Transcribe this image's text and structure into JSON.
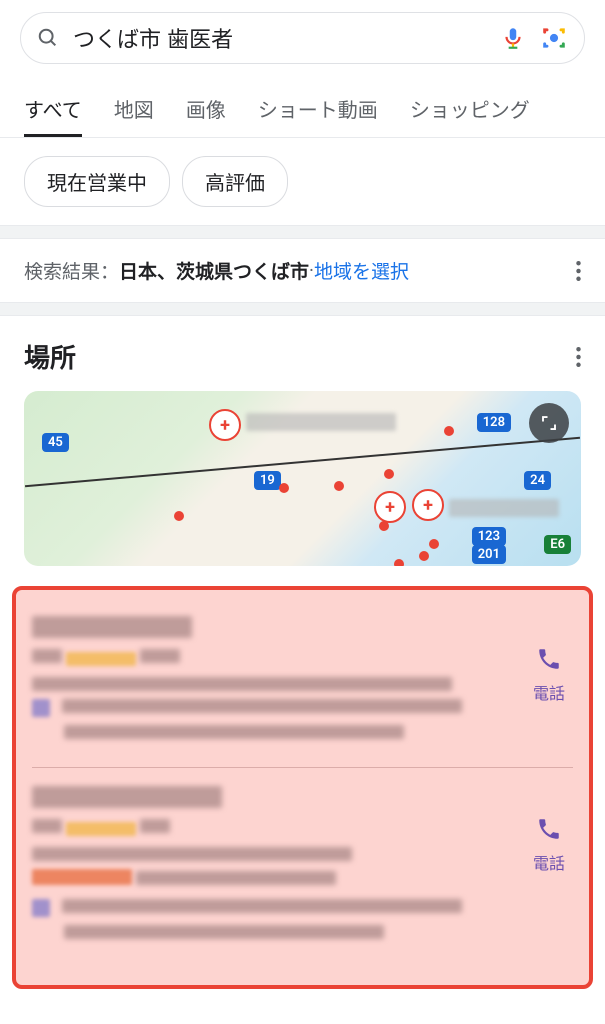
{
  "search": {
    "query": "つくば市 歯医者"
  },
  "tabs": [
    {
      "label": "すべて",
      "active": true
    },
    {
      "label": "地図",
      "active": false
    },
    {
      "label": "画像",
      "active": false
    },
    {
      "label": "ショート動画",
      "active": false
    },
    {
      "label": "ショッピング",
      "active": false
    }
  ],
  "filters": [
    {
      "label": "現在営業中"
    },
    {
      "label": "高評価"
    }
  ],
  "location": {
    "prefix": "検索結果：",
    "value": "日本、茨城県つくば市",
    "separator": " · ",
    "change_link": "地域を選択"
  },
  "places": {
    "title": "場所"
  },
  "map": {
    "route_labels": [
      "45",
      "128",
      "19",
      "24",
      "123",
      "201",
      "E6"
    ]
  },
  "call_label": "電話",
  "colors": {
    "accent": "#1a73e8",
    "danger": "#ea4335",
    "call": "#6b4faf"
  }
}
